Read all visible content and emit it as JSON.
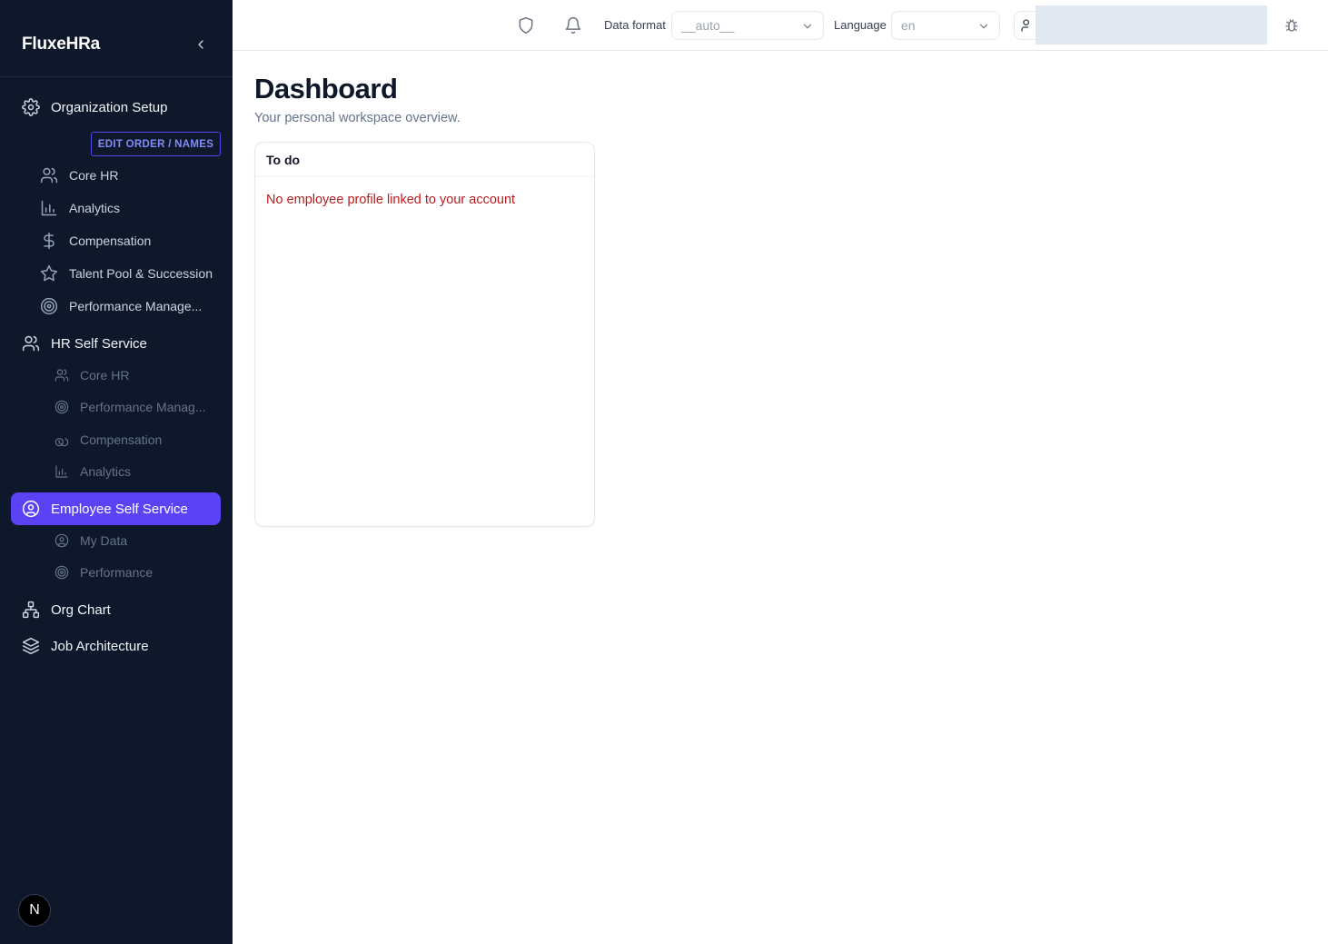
{
  "app": {
    "brand": "FluxeHRa"
  },
  "sidebar": {
    "edit_order_label": "EDIT ORDER / NAMES",
    "org_setup": {
      "label": "Organization Setup",
      "items": [
        {
          "label": "Core HR",
          "icon": "users-icon"
        },
        {
          "label": "Analytics",
          "icon": "bar-chart-icon"
        },
        {
          "label": "Compensation",
          "icon": "dollar-icon"
        },
        {
          "label": "Talent Pool & Succession",
          "icon": "star-icon"
        },
        {
          "label": "Performance Manage...",
          "icon": "target-icon"
        }
      ]
    },
    "hr_self_service": {
      "label": "HR Self Service",
      "items": [
        {
          "label": "Core HR",
          "icon": "users-icon"
        },
        {
          "label": "Performance Manag...",
          "icon": "target-icon"
        },
        {
          "label": "Compensation",
          "icon": "coins-icon"
        },
        {
          "label": "Analytics",
          "icon": "bar-chart-icon"
        }
      ]
    },
    "employee_self_service": {
      "label": "Employee Self Service",
      "items": [
        {
          "label": "My Data",
          "icon": "user-circle-icon"
        },
        {
          "label": "Performance",
          "icon": "target-icon"
        }
      ]
    },
    "org_chart": {
      "label": "Org Chart"
    },
    "job_architecture": {
      "label": "Job Architecture"
    },
    "badge_letter": "N"
  },
  "topbar": {
    "data_format_label": "Data format",
    "data_format_value": "__auto__",
    "language_label": "Language",
    "language_value": "en"
  },
  "main": {
    "title": "Dashboard",
    "subtitle": "Your personal workspace overview.",
    "card": {
      "title": "To do",
      "message": "No employee profile linked to your account"
    }
  },
  "colors": {
    "sidebar_bg": "#0f172a",
    "accent": "#5b43f5",
    "error_text": "#b91c1c"
  }
}
